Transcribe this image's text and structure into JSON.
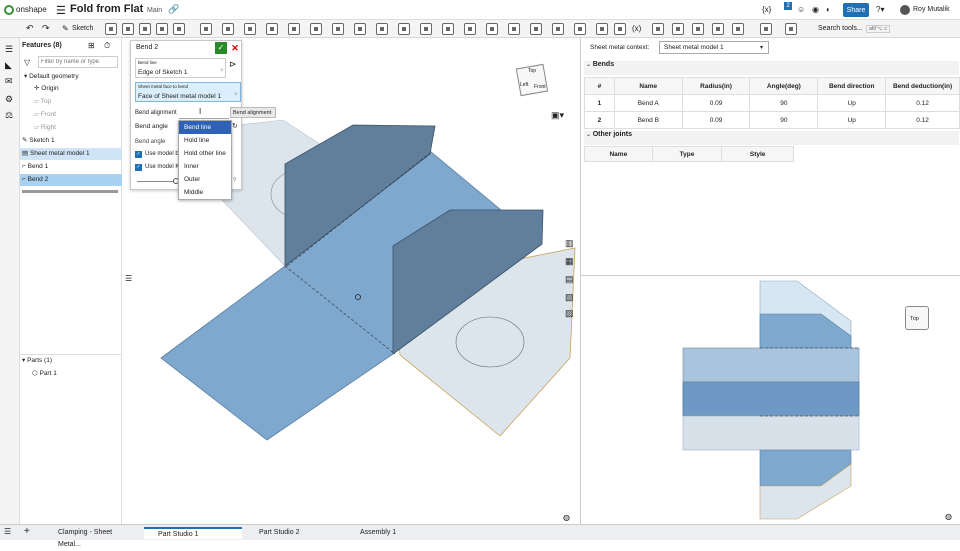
{
  "app": {
    "logo_text": "onshape",
    "doc_title": "Fold from Flat",
    "branch": "Main",
    "user": "Roy Mutalik",
    "share": "Share",
    "search_tools": "Search tools...",
    "search_shortcut": "alt/⌥ c",
    "notif_count": "2"
  },
  "toolbar": {
    "sketch": "Sketch"
  },
  "features": {
    "header": "Features (8)",
    "filter_placeholder": "Filter by name or type",
    "items": [
      {
        "label": "Default geometry"
      },
      {
        "label": "Origin"
      },
      {
        "label": "Top"
      },
      {
        "label": "Front"
      },
      {
        "label": "Right"
      },
      {
        "label": "Sketch 1"
      },
      {
        "label": "Sheet metal model 1"
      },
      {
        "label": "Bend 1"
      },
      {
        "label": "Bend 2"
      }
    ],
    "parts_header": "Parts (1)",
    "parts": [
      {
        "label": "Part 1"
      }
    ]
  },
  "dialog": {
    "title": "Bend 2",
    "bend_line_label": "Bend line",
    "bend_line_value": "Edge of Sketch 1",
    "face_label": "Sheet metal face to bend",
    "face_value": "Face of Sheet metal model 1",
    "alignment_label": "Bend alignment",
    "bend_angle_label": "Bend angle",
    "bend_angle_label2": "Bend angle",
    "use_model_b": "Use model b",
    "use_model_k": "Use model K",
    "tooltip": "Bend alignment"
  },
  "dropdown": {
    "options": [
      "Bend line",
      "Hold line",
      "Hold other line",
      "Inner",
      "Outer",
      "Middle"
    ],
    "selected": "Bend line"
  },
  "sheet": {
    "context_label": "Sheet metal context:",
    "context_value": "Sheet metal model 1",
    "bends_title": "Bends",
    "columns": [
      "#",
      "Name",
      "Radius(in)",
      "Angle(deg)",
      "Bend direction",
      "Bend deduction(in)"
    ],
    "rows": [
      [
        "1",
        "Bend A",
        "0.09",
        "90",
        "Up",
        "0.12"
      ],
      [
        "2",
        "Bend B",
        "0.09",
        "90",
        "Up",
        "0.12"
      ]
    ],
    "joints_title": "Other joints",
    "joint_columns": [
      "Name",
      "Type",
      "Style"
    ]
  },
  "viewcube": {
    "top": "Top",
    "left": "Left",
    "front": "Front",
    "top2": "Top"
  },
  "tabs": [
    {
      "label": "Clamping - Sheet Metal..."
    },
    {
      "label": "Part Studio 1"
    },
    {
      "label": "Part Studio 2"
    },
    {
      "label": "Assembly 1"
    }
  ],
  "colors": {
    "accent": "#1f6fb5",
    "part": "#6d99c4",
    "part_light": "#d6e1ea",
    "selected": "#cfe4f6"
  }
}
